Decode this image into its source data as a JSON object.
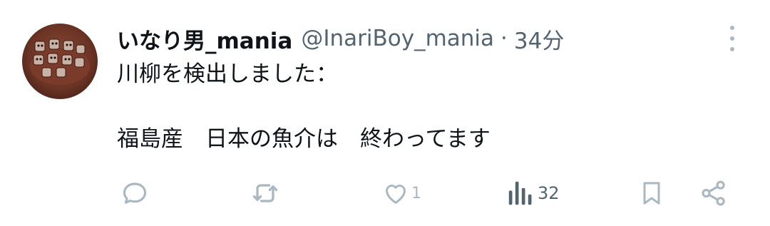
{
  "tweet": {
    "display_name": "いなり男_mania",
    "handle": "@InariBoy_mania",
    "separator": "·",
    "time": "34分",
    "lines": [
      "川柳を検出しました：",
      "福島産　日本の魚介は　終わってます"
    ]
  },
  "actions": {
    "reply": {
      "icon": "reply-icon"
    },
    "retweet": {
      "icon": "retweet-icon"
    },
    "like": {
      "icon": "heart-icon",
      "count": "1"
    },
    "views": {
      "icon": "views-icon",
      "count": "32"
    },
    "bookmark": {
      "icon": "bookmark-icon"
    },
    "share": {
      "icon": "share-icon"
    }
  },
  "colors": {
    "text": "#0f1419",
    "secondary": "#536471",
    "icon_light": "#aab8c2"
  }
}
